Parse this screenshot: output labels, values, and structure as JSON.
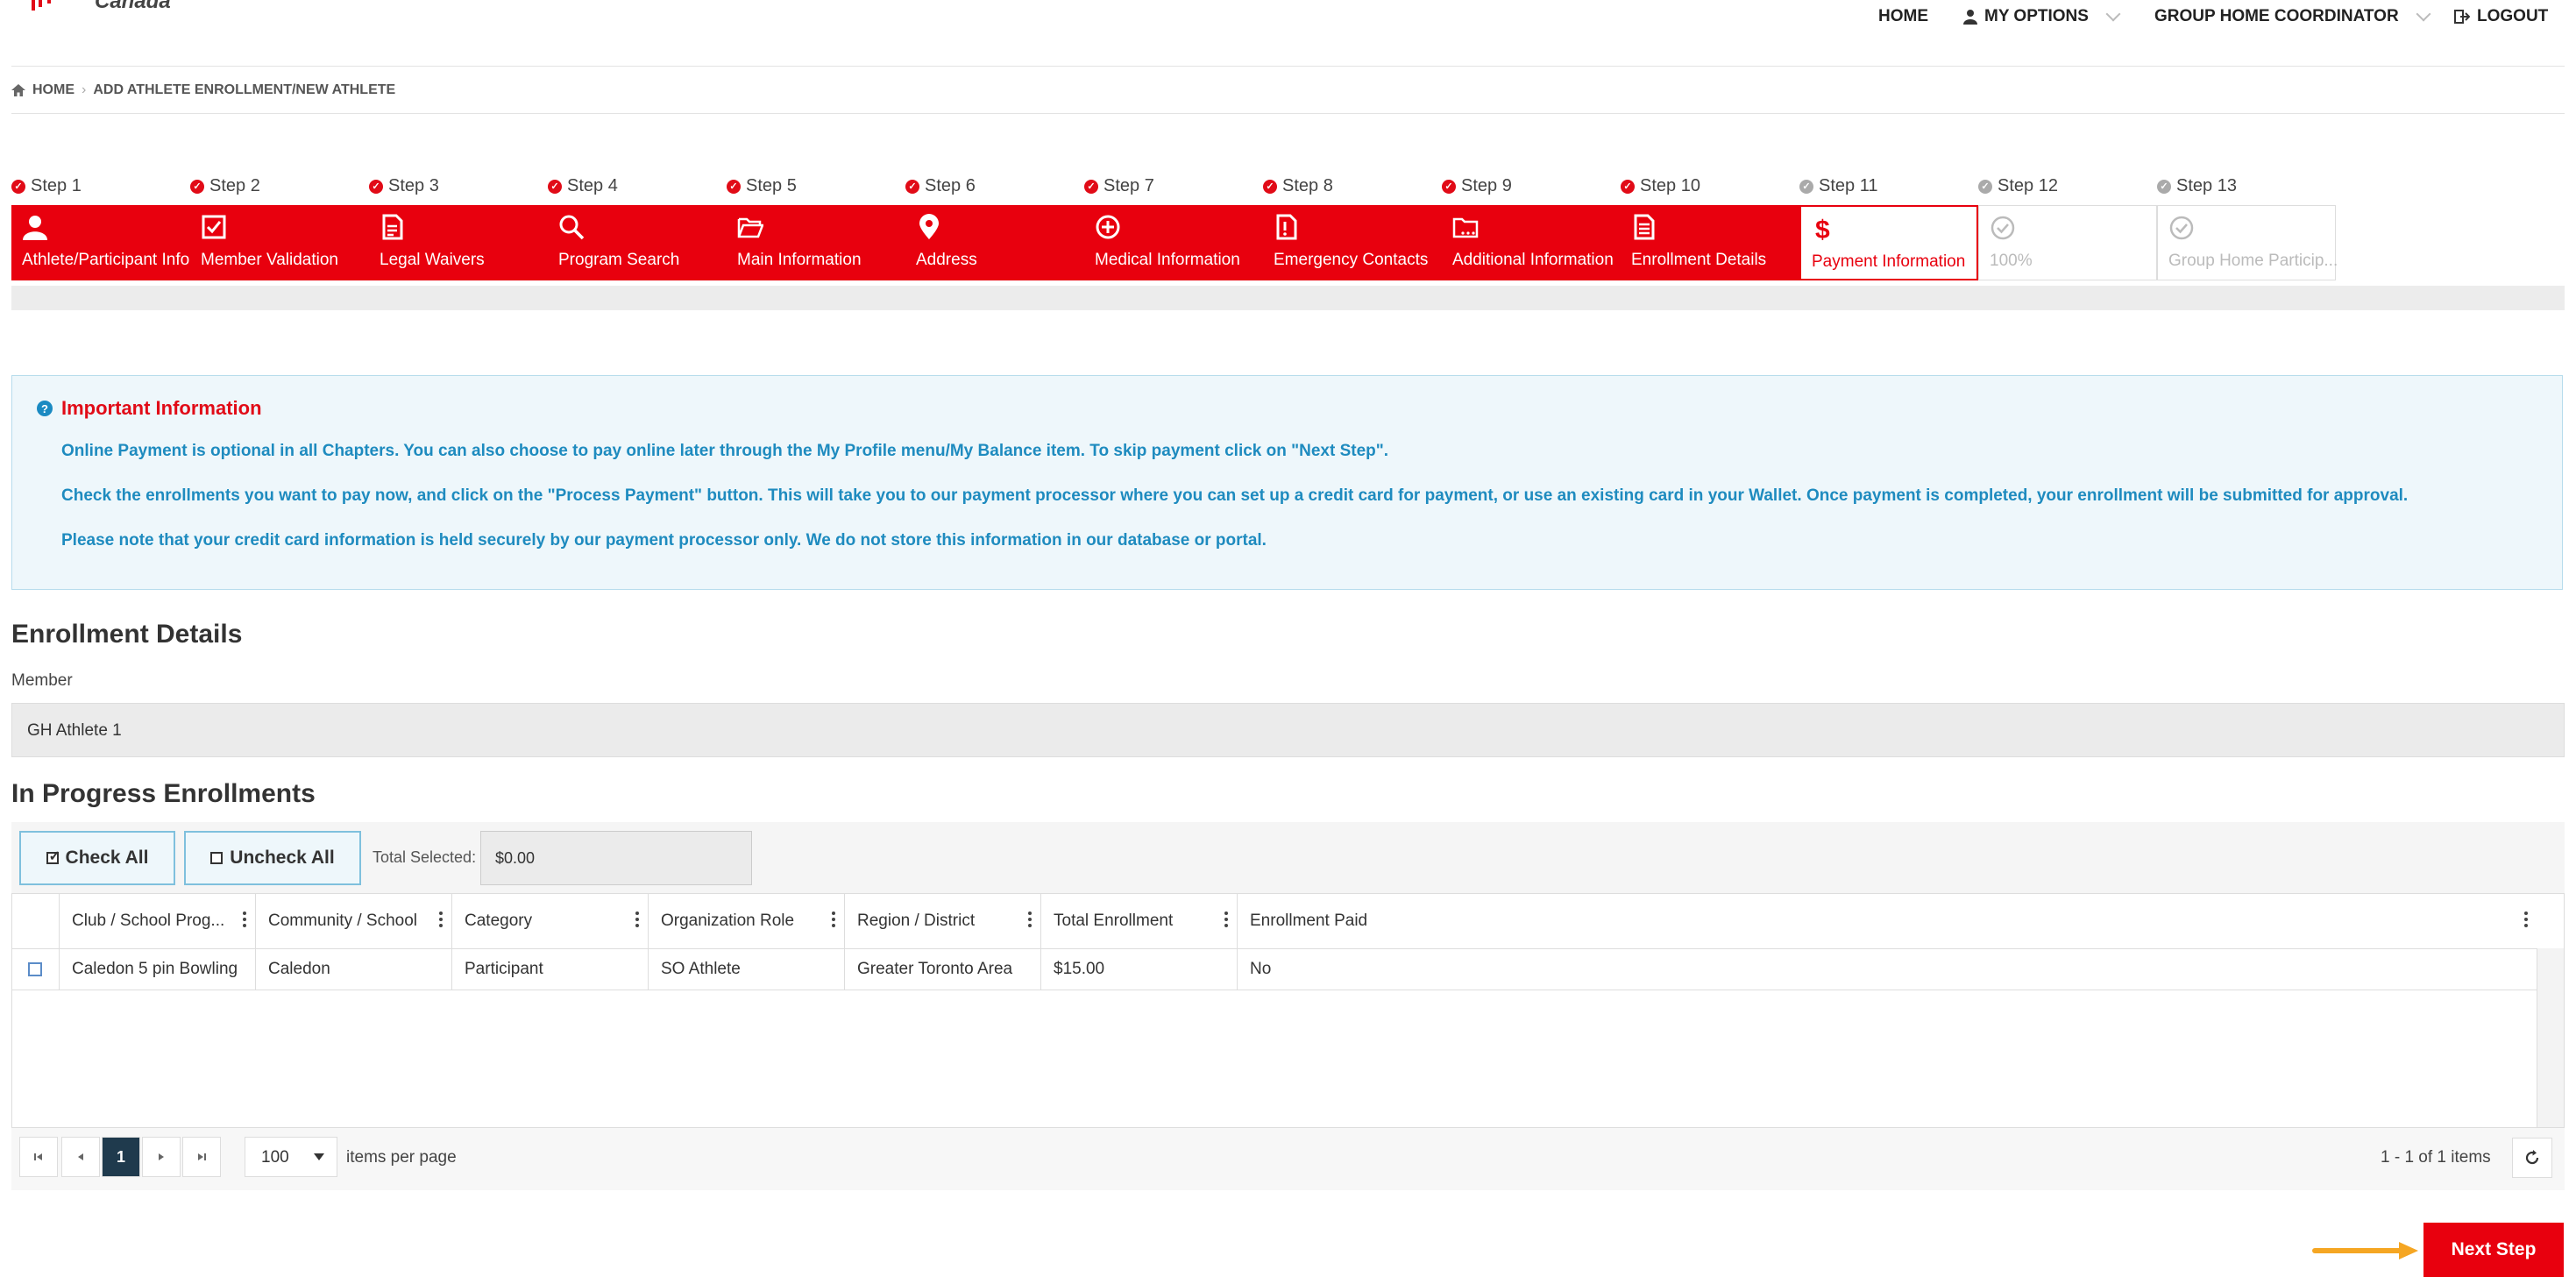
{
  "header": {
    "brand_text": "Canada",
    "nav": {
      "home": "HOME",
      "my_options": "MY OPTIONS",
      "role": "GROUP HOME COORDINATOR",
      "logout": "LOGOUT"
    }
  },
  "breadcrumb": {
    "home": "HOME",
    "current": "ADD ATHLETE ENROLLMENT/NEW ATHLETE"
  },
  "steps": [
    {
      "step": "Step 1",
      "label": "Athlete/Participant Info",
      "status": "done",
      "icon": "person-icon"
    },
    {
      "step": "Step 2",
      "label": "Member Validation",
      "status": "done",
      "icon": "checkbox-icon"
    },
    {
      "step": "Step 3",
      "label": "Legal Waivers",
      "status": "done",
      "icon": "document-icon"
    },
    {
      "step": "Step 4",
      "label": "Program Search",
      "status": "done",
      "icon": "search-icon"
    },
    {
      "step": "Step 5",
      "label": "Main Information",
      "status": "done",
      "icon": "folder-open-icon"
    },
    {
      "step": "Step 6",
      "label": "Address",
      "status": "done",
      "icon": "map-pin-icon"
    },
    {
      "step": "Step 7",
      "label": "Medical Information",
      "status": "done",
      "icon": "plus-circle-icon"
    },
    {
      "step": "Step 8",
      "label": "Emergency Contacts",
      "status": "done",
      "icon": "alert-doc-icon"
    },
    {
      "step": "Step 9",
      "label": "Additional Information",
      "status": "done",
      "icon": "folder-more-icon"
    },
    {
      "step": "Step 10",
      "label": "Enrollment Details",
      "status": "done",
      "icon": "file-text-icon"
    },
    {
      "step": "Step 11",
      "label": "Payment Information",
      "status": "active",
      "icon": "dollar-icon"
    },
    {
      "step": "Step 12",
      "label": "100%",
      "status": "todo",
      "icon": "check-circle-icon"
    },
    {
      "step": "Step 13",
      "label": "Group Home Particip...",
      "status": "todo",
      "icon": "check-circle-icon"
    }
  ],
  "info": {
    "title": "Important Information",
    "lines": [
      "Online Payment is optional in all Chapters.  You can also choose to pay online later through the My Profile menu/My Balance item.  To skip payment click on \"Next Step\".",
      "Check the enrollments you want to pay now, and click on the \"Process Payment\" button.  This will take you to our payment processor where you can set up a credit card for payment, or use an existing card in your Wallet. Once payment is completed, your enrollment will be submitted for approval.",
      "Please note that your credit card information is held securely by our payment processor only.  We do not store this information in our database or portal."
    ]
  },
  "enrollment_details": {
    "heading": "Enrollment Details",
    "member_label": "Member",
    "member_value": "GH Athlete 1"
  },
  "in_progress": {
    "heading": "In Progress Enrollments",
    "check_all": "Check All",
    "uncheck_all": "Uncheck All",
    "total_label": "Total Selected:",
    "total_value": "$0.00",
    "columns": [
      "Club / School Prog...",
      "Community / School",
      "Category",
      "Organization Role",
      "Region / District",
      "Total Enrollment",
      "Enrollment Paid"
    ],
    "rows": [
      [
        "Caledon 5 pin Bowling",
        "Caledon",
        "Participant",
        "SO Athlete",
        "Greater Toronto Area",
        "$15.00",
        "No"
      ]
    ]
  },
  "pager": {
    "current_page": "1",
    "page_size": "100",
    "items_per_page": "items per page",
    "summary": "1 - 1 of 1 items"
  },
  "actions": {
    "next_step": "Next Step"
  },
  "colors": {
    "brand_red": "#e8000e",
    "info_blue": "#1e8bbf",
    "pager_active": "#1f3a4d",
    "arrow_orange": "#f5a623"
  }
}
